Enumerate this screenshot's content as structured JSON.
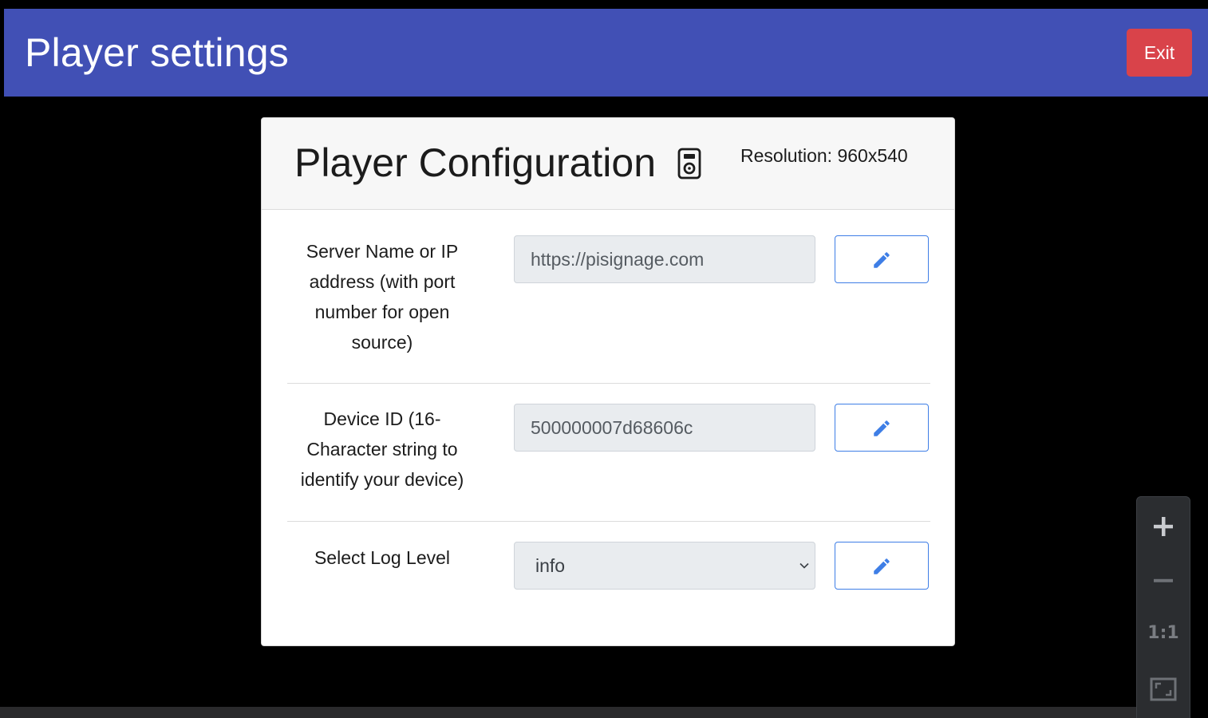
{
  "header": {
    "title": "Player settings",
    "exit_label": "Exit",
    "bar_color": "#4150b5",
    "exit_color": "#d9434a"
  },
  "card": {
    "title": "Player Configuration",
    "title_icon": "media-player-icon",
    "resolution": "Resolution: 960x540"
  },
  "rows": [
    {
      "label": "Server Name or IP address (with port number for open source)",
      "value": "https://pisignage.com",
      "type": "text",
      "action_icon": "pencil-icon"
    },
    {
      "label": "Device ID (16-Character string to identify your device)",
      "value": "500000007d68606c",
      "type": "text",
      "action_icon": "pencil-icon"
    },
    {
      "label": "Select Log Level",
      "value": "info",
      "type": "select",
      "action_icon": "pencil-icon"
    }
  ],
  "zoom": {
    "zoom_in_icon": "plus-icon",
    "zoom_out_icon": "minus-icon",
    "actual_size_label": "1:1",
    "fit_icon": "fit-screen-icon"
  }
}
